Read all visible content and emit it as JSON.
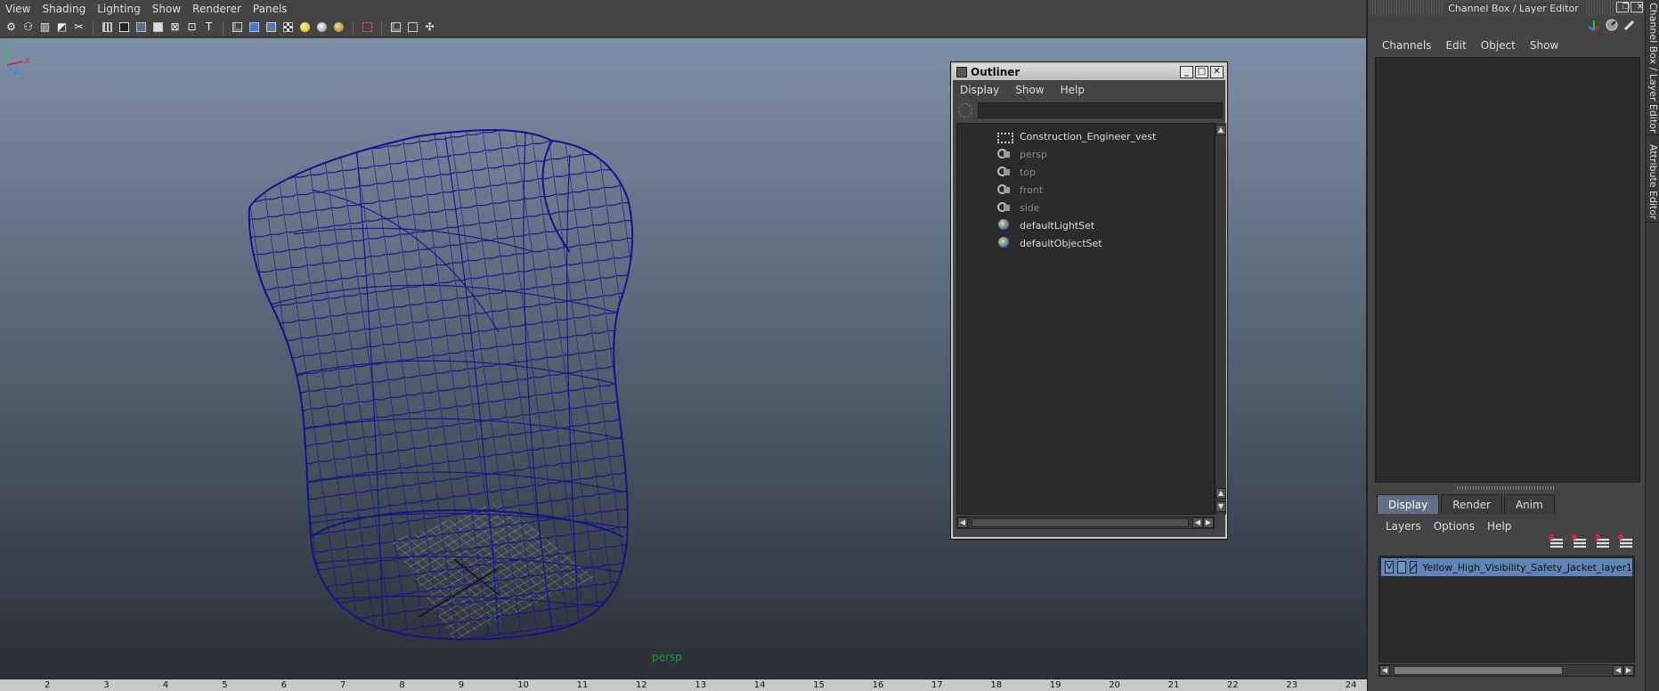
{
  "viewport": {
    "menu": [
      "View",
      "Shading",
      "Lighting",
      "Show",
      "Renderer",
      "Panels"
    ],
    "camera_label": "persp",
    "axis": {
      "x": "X",
      "y": "Y",
      "z": "Z"
    }
  },
  "timeline": {
    "ticks": [
      "2",
      "3",
      "4",
      "5",
      "6",
      "7",
      "8",
      "9",
      "10",
      "11",
      "12",
      "13",
      "14",
      "15",
      "16",
      "17",
      "18",
      "19",
      "20",
      "21",
      "22",
      "23",
      "24"
    ]
  },
  "outliner": {
    "title": "Outliner",
    "menu": [
      "Display",
      "Show",
      "Help"
    ],
    "search_value": "",
    "items": [
      {
        "label": "Construction_Engineer_vest",
        "icon": "group-icon",
        "dim": false
      },
      {
        "label": "persp",
        "icon": "camera-icon",
        "dim": true
      },
      {
        "label": "top",
        "icon": "camera-icon",
        "dim": true
      },
      {
        "label": "front",
        "icon": "camera-icon",
        "dim": true
      },
      {
        "label": "side",
        "icon": "camera-icon",
        "dim": true
      },
      {
        "label": "defaultLightSet",
        "icon": "set-icon",
        "dim": false
      },
      {
        "label": "defaultObjectSet",
        "icon": "set-icon",
        "dim": false
      }
    ]
  },
  "dock": {
    "title": "Channel Box / Layer Editor",
    "channel_menu": [
      "Channels",
      "Edit",
      "Object",
      "Show"
    ],
    "layer_tabs": [
      "Display",
      "Render",
      "Anim"
    ],
    "active_tab": "Display",
    "layer_menu": [
      "Layers",
      "Options",
      "Help"
    ],
    "layer": {
      "visibility": "V",
      "name": "Yellow_High_Visibility_Safety_Jacket_layer1"
    },
    "side_tabs": [
      "Channel Box / Layer Editor",
      "Attribute Editor"
    ]
  },
  "colors": {
    "wire": "#14148a",
    "layer_highlight": "#5e86b5",
    "camera_label": "#1a9a2a"
  }
}
